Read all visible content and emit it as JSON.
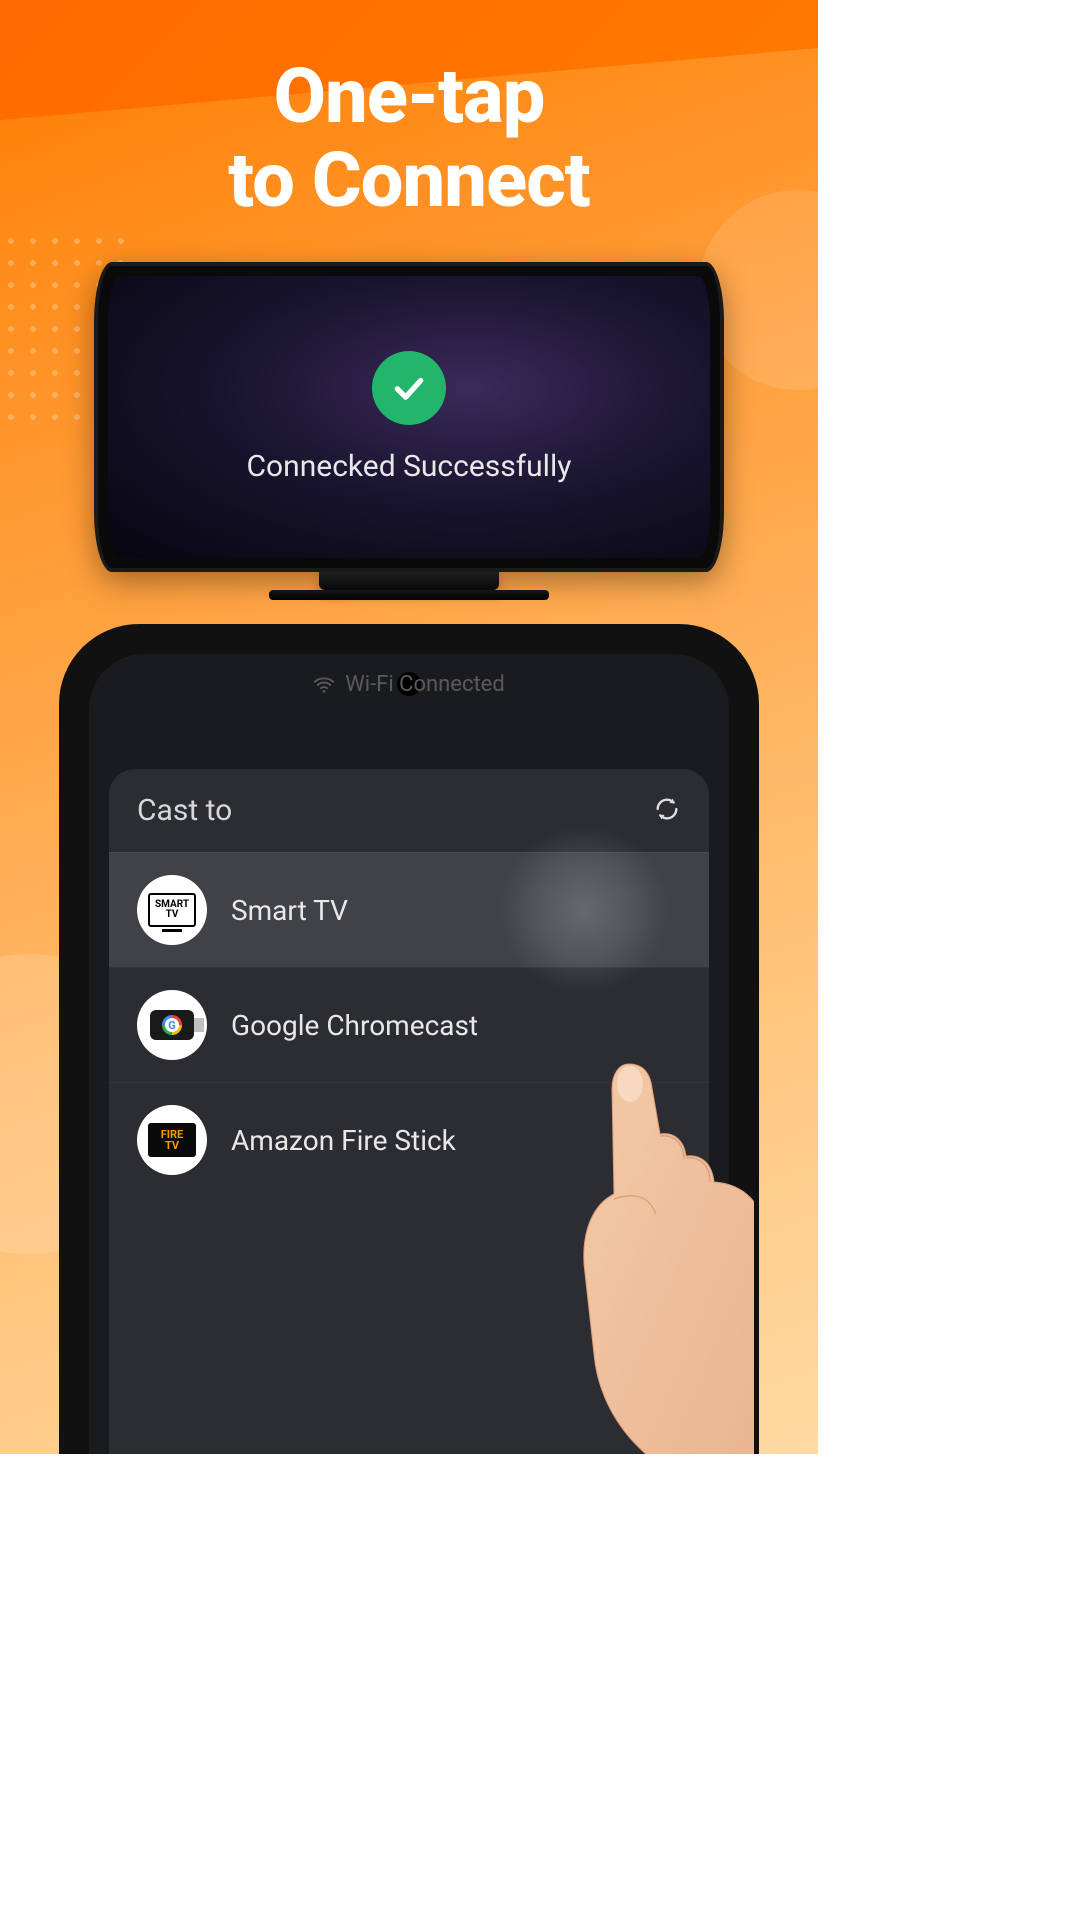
{
  "headline": {
    "line1": "One-tap",
    "line2": "to Connect"
  },
  "tv": {
    "status_text": "Connecked Successfully"
  },
  "phone": {
    "wifi_status": "Wi-Fi Connected",
    "cast_panel": {
      "title": "Cast to",
      "devices": [
        {
          "label": "Smart TV",
          "icon": "smart-tv",
          "highlighted": true
        },
        {
          "label": "Google Chromecast",
          "icon": "chromecast",
          "highlighted": false
        },
        {
          "label": "Amazon Fire Stick",
          "icon": "fire-tv",
          "highlighted": false
        }
      ]
    }
  },
  "icons": {
    "smart_tv_line1": "SMART",
    "smart_tv_line2": "TV",
    "fire_tv_line1": "FIRE",
    "fire_tv_line2": "TV"
  },
  "colors": {
    "accent": "#ff7a00",
    "success": "#22b66b"
  }
}
